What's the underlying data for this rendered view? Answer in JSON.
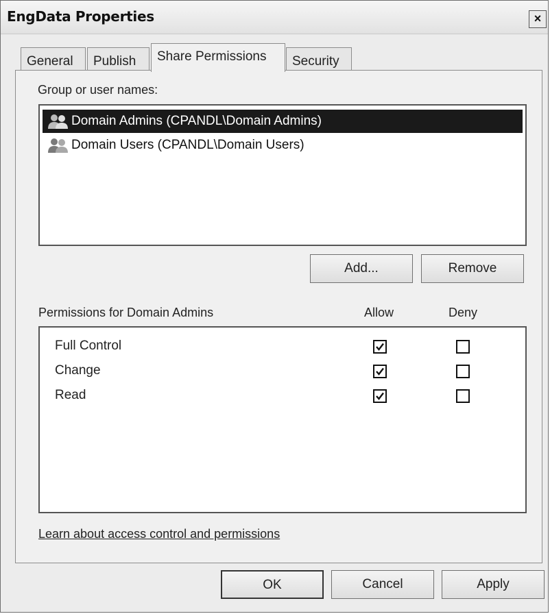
{
  "window": {
    "title": "EngData Properties",
    "close_glyph": "×"
  },
  "tabs": [
    {
      "label": "General",
      "active": false
    },
    {
      "label": "Publish",
      "active": false
    },
    {
      "label": "Share Permissions",
      "active": true
    },
    {
      "label": "Security",
      "active": false
    }
  ],
  "group_section": {
    "label": "Group or user names:",
    "users": [
      {
        "name": "Domain Admins (CPANDL\\Domain Admins)",
        "icon": "users-group-icon",
        "selected": true
      },
      {
        "name": "Domain Users (CPANDL\\Domain Users)",
        "icon": "users-group-icon",
        "selected": false
      }
    ],
    "add_label": "Add...",
    "remove_label": "Remove"
  },
  "permissions": {
    "label": "Permissions for Domain Admins",
    "allow_header": "Allow",
    "deny_header": "Deny",
    "rows": [
      {
        "name": "Full Control",
        "allow": true,
        "deny": false
      },
      {
        "name": "Change",
        "allow": true,
        "deny": false
      },
      {
        "name": "Read",
        "allow": true,
        "deny": false
      }
    ]
  },
  "link": {
    "text": "Learn about access control and permissions"
  },
  "footer": {
    "ok_label": "OK",
    "cancel_label": "Cancel",
    "apply_label": "Apply"
  }
}
